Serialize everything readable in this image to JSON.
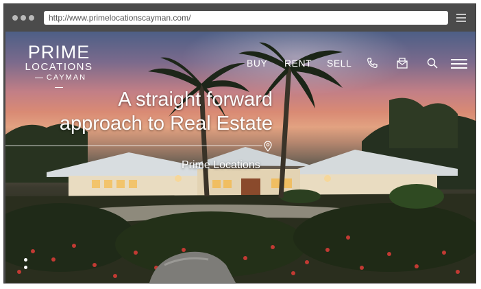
{
  "browser": {
    "url": "http://www.primelocationscayman.com/"
  },
  "logo": {
    "line1": "PRIME",
    "line2": "LOCATIONS",
    "line3": "CAYMAN"
  },
  "nav": {
    "items": [
      {
        "label": "BUY"
      },
      {
        "label": "RENT"
      },
      {
        "label": "SELL"
      }
    ],
    "icons": [
      "phone-icon",
      "mail-icon",
      "search-icon",
      "hamburger-menu-icon"
    ]
  },
  "hero": {
    "headline_line1": "A straight forward",
    "headline_line2": "approach to Real Estate",
    "location_label": "Prime Locations",
    "slides_count": 2
  },
  "colors": {
    "text": "#ffffff",
    "chrome": "#4b4b4b",
    "sky_top": "#4d5f86",
    "sky_glow": "#e2a281",
    "foliage": "#1d2215"
  }
}
